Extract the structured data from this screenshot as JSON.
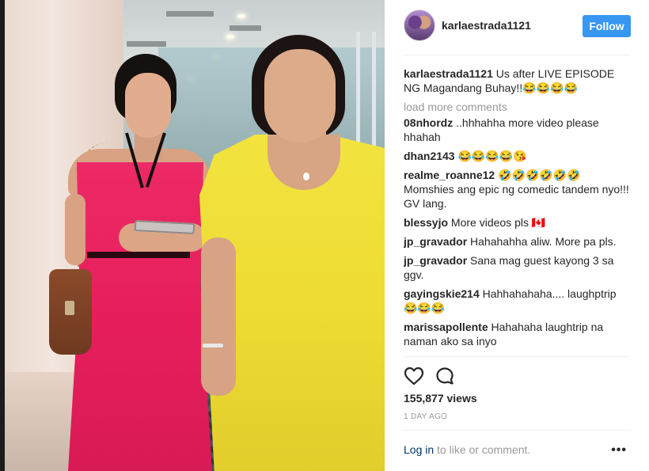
{
  "post": {
    "username": "karlaestrada1121",
    "follow_label": "Follow",
    "caption_user": "karlaestrada1121",
    "caption_text": "Us after LIVE EPISODE NG Magandang Buhay!!😂😂😂😂",
    "load_more": "load more comments",
    "comments": [
      {
        "user": "08nhordz",
        "text": "..hhhahha more video please hhahah"
      },
      {
        "user": "dhan2143",
        "text": "😂😂😂😂😘"
      },
      {
        "user": "realme_roanne12",
        "text": "🤣🤣🤣🤣🤣🤣 Momshies ang epic ng comedic tandem nyo!!! GV lang."
      },
      {
        "user": "blessyjo",
        "text": "More videos pls 🇨🇦"
      },
      {
        "user": "jp_gravador",
        "text": "Hahahahha aliw. More pa pls."
      },
      {
        "user": "jp_gravador",
        "text": "Sana mag guest kayong 3 sa ggv."
      },
      {
        "user": "gayingskie214",
        "text": "Hahhahahaha.... laughptrip 😂😂😂"
      },
      {
        "user": "marissapollente",
        "text": "Hahahaha laughtrip na naman ako sa inyo"
      }
    ],
    "views": "155,877 views",
    "time_ago": "1 DAY AGO",
    "login_link": "Log in",
    "login_rest": " to like or comment.",
    "more_icon": "•••"
  }
}
